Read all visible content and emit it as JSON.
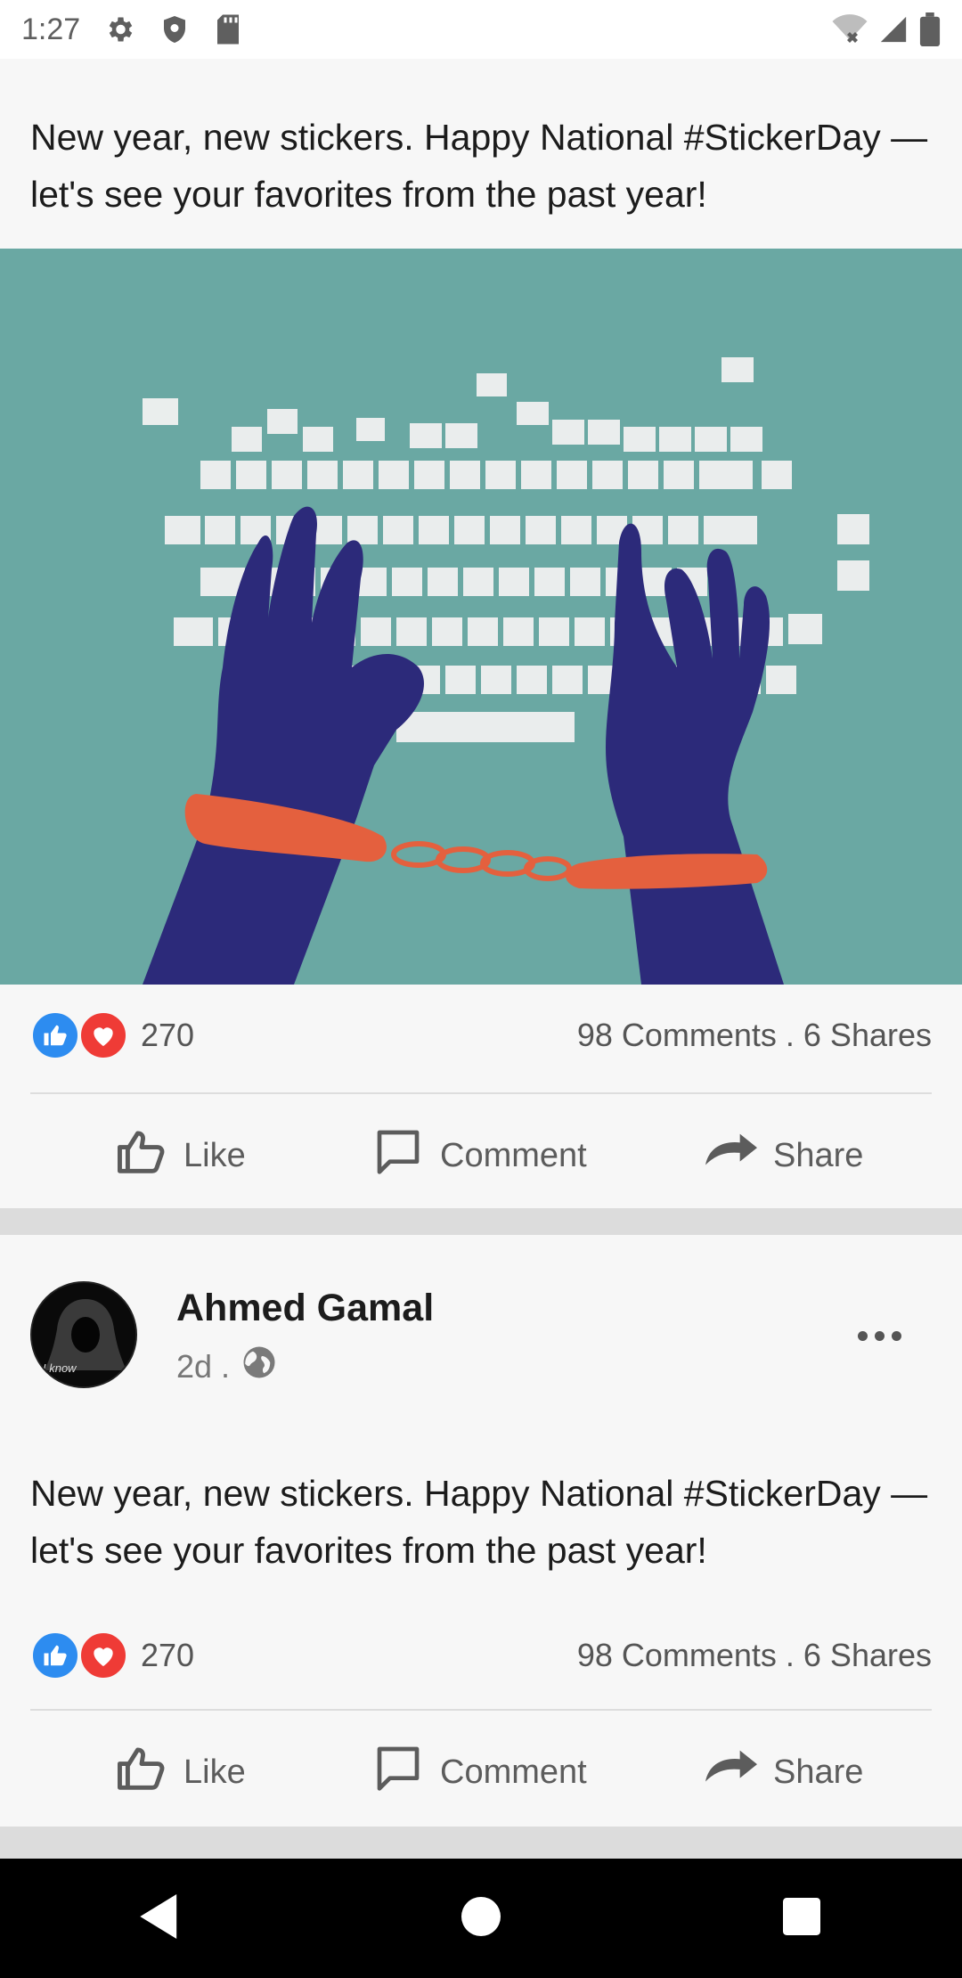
{
  "status_bar": {
    "time": "1:27",
    "icons": [
      "gear-icon",
      "shield-icon",
      "sd-card-icon",
      "wifi-off-icon",
      "cell-signal-icon",
      "battery-icon"
    ]
  },
  "posts": [
    {
      "text": "New year, new stickers. Happy National #StickerDay —let's see your favorites from the past year!",
      "reactions": {
        "count": "270",
        "types": [
          "like",
          "love"
        ]
      },
      "comments_shares": "98 Comments . 6 Shares",
      "actions": {
        "like": "Like",
        "comment": "Comment",
        "share": "Share"
      }
    },
    {
      "author": {
        "name": "Ahmed Gamal",
        "time": "2d .",
        "avatar_text": "I know"
      },
      "text": "New year, new stickers. Happy National #StickerDay —let's see your favorites from the past year!",
      "reactions": {
        "count": "270",
        "types": [
          "like",
          "love"
        ]
      },
      "comments_shares": "98 Comments . 6 Shares",
      "actions": {
        "like": "Like",
        "comment": "Comment",
        "share": "Share"
      }
    }
  ],
  "colors": {
    "like_blue": "#2d8cf0",
    "love_red": "#ef3b36",
    "image_bg": "#6aa8a3",
    "hands": "#2c2a7a",
    "cuffs": "#e4603e"
  },
  "nav_bar": {
    "icons": [
      "back-icon",
      "home-icon",
      "recents-icon"
    ]
  }
}
